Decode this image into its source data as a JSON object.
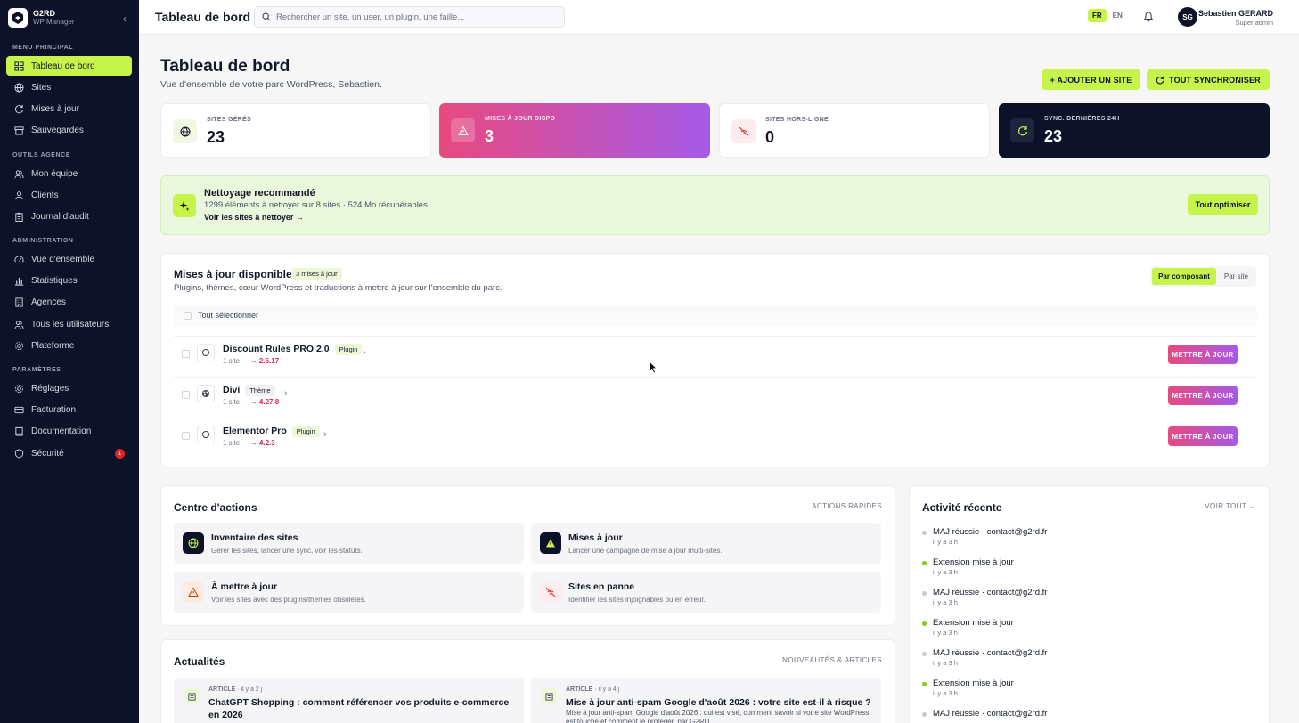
{
  "brand": {
    "name": "G2RD",
    "sub": "WP Manager"
  },
  "sidebar": {
    "sections": [
      "MENU PRINCIPAL",
      "OUTILS AGENCE",
      "ADMINISTRATION",
      "PARAMÈTRES"
    ],
    "items": [
      {
        "label": "Tableau de bord",
        "icon": "grid-icon"
      },
      {
        "label": "Sites",
        "icon": "globe-icon"
      },
      {
        "label": "Mises à jour",
        "icon": "refresh-icon"
      },
      {
        "label": "Sauvegardes",
        "icon": "archive-icon"
      },
      {
        "label": "Mon équipe",
        "icon": "users-icon"
      },
      {
        "label": "Clients",
        "icon": "user-icon"
      },
      {
        "label": "Journal d'audit",
        "icon": "clipboard-icon"
      },
      {
        "label": "Vue d'ensemble",
        "icon": "gauge-icon"
      },
      {
        "label": "Statistiques",
        "icon": "bar-chart-icon"
      },
      {
        "label": "Agences",
        "icon": "building-icon"
      },
      {
        "label": "Tous les utilisateurs",
        "icon": "users-icon"
      },
      {
        "label": "Plateforme",
        "icon": "gear-icon"
      },
      {
        "label": "Réglages",
        "icon": "gear-icon"
      },
      {
        "label": "Facturation",
        "icon": "credit-card-icon"
      },
      {
        "label": "Documentation",
        "icon": "book-icon"
      },
      {
        "label": "Sécurité",
        "icon": "shield-icon",
        "badge": "1"
      }
    ]
  },
  "topbar": {
    "title": "Tableau de bord",
    "search_placeholder": "Rechercher un site, un user, un plugin, une faille...",
    "lang": [
      "FR",
      "EN"
    ],
    "user_initials": "SG",
    "user_name": "Sebastien GERARD",
    "user_role": "Super admin"
  },
  "page": {
    "title": "Tableau de bord",
    "subtitle": "Vue d'ensemble de votre parc WordPress, Sebastien.",
    "add_site": "+ AJOUTER UN SITE",
    "sync_all": "TOUT SYNCHRONISER"
  },
  "stats": [
    {
      "label": "SITES GÉRÉS",
      "value": "23"
    },
    {
      "label": "MISES À JOUR DISPO",
      "value": "3"
    },
    {
      "label": "SITES HORS-LIGNE",
      "value": "0"
    },
    {
      "label": "SYNC. DERNIÈRES 24H",
      "value": "23"
    }
  ],
  "cleanup": {
    "title": "Nettoyage recommandé",
    "desc": "1299 éléments à nettoyer sur 8 sites · 524 Mo récupérables",
    "link": "Voir les sites à nettoyer →",
    "button": "Tout optimiser"
  },
  "updates": {
    "title": "Mises à jour disponibles",
    "count_badge": "3 mises à jour",
    "desc": "Plugins, thèmes, cœur WordPress et traductions à mettre à jour sur l'ensemble du parc.",
    "toggle": [
      "Par composant",
      "Par site"
    ],
    "select_all": "Tout sélectionner",
    "items": [
      {
        "name": "Discount Rules PRO 2.0",
        "type": "Plugin",
        "sites": "1 site",
        "version": "→ 2.6.17"
      },
      {
        "name": "Divi",
        "type": "Thème",
        "sites": "1 site",
        "version": "→ 4.27.8"
      },
      {
        "name": "Elementor Pro",
        "type": "Plugin",
        "sites": "1 site",
        "version": "→ 4.2.3"
      }
    ],
    "update_label": "METTRE À JOUR",
    "sep": "·"
  },
  "actions": {
    "title": "Centre d'actions",
    "quick": "ACTIONS RAPIDES",
    "tiles": [
      {
        "title": "Inventaire des sites",
        "desc": "Gérer les sites, lancer une sync, voir les statuts."
      },
      {
        "title": "Mises à jour",
        "desc": "Lancer une campagne de mise à jour multi-sites."
      },
      {
        "title": "À mettre à jour",
        "desc": "Voir les sites avec des plugins/thèmes obsolètes."
      },
      {
        "title": "Sites en panne",
        "desc": "Identifier les sites injoignables ou en erreur."
      }
    ]
  },
  "activity": {
    "title": "Activité récente",
    "see_all": "VOIR TOUT →",
    "items": [
      {
        "text": "MAJ réussie · contact@g2rd.fr",
        "time": "il y a 3 h",
        "color": "#c7c9d1"
      },
      {
        "text": "Extension mise à jour",
        "time": "il y a 3 h",
        "color": "#84cc16"
      },
      {
        "text": "MAJ réussie · contact@g2rd.fr",
        "time": "il y a 3 h",
        "color": "#c7c9d1"
      },
      {
        "text": "Extension mise à jour",
        "time": "il y a 3 h",
        "color": "#84cc16"
      },
      {
        "text": "MAJ réussie · contact@g2rd.fr",
        "time": "il y a 3 h",
        "color": "#c7c9d1"
      },
      {
        "text": "Extension mise à jour",
        "time": "il y a 3 h",
        "color": "#84cc16"
      },
      {
        "text": "MAJ réussie · contact@g2rd.fr",
        "time": "",
        "color": "#c7c9d1"
      }
    ]
  },
  "news": {
    "title": "Actualités",
    "link": "NOUVEAUTÉS & ARTICLES",
    "items": [
      {
        "tag": "ARTICLE",
        "age": "· il y a 2 j",
        "title": "ChatGPT Shopping : comment référencer vos produits e-commerce en 2026",
        "desc": ""
      },
      {
        "tag": "ARTICLE",
        "age": "· il y a 4 j",
        "title": "Mise à jour anti-spam Google d'août 2026 : votre site est-il à risque ?",
        "desc": "Mise à jour anti-spam Google d'août 2026 : qui est visé, comment savoir si votre site WordPress est touché et comment le protéger, par G2RD."
      }
    ]
  },
  "colors": {
    "accent": "#c6f44a",
    "sidebar": "#0d1228",
    "danger": "#e84a7f"
  }
}
